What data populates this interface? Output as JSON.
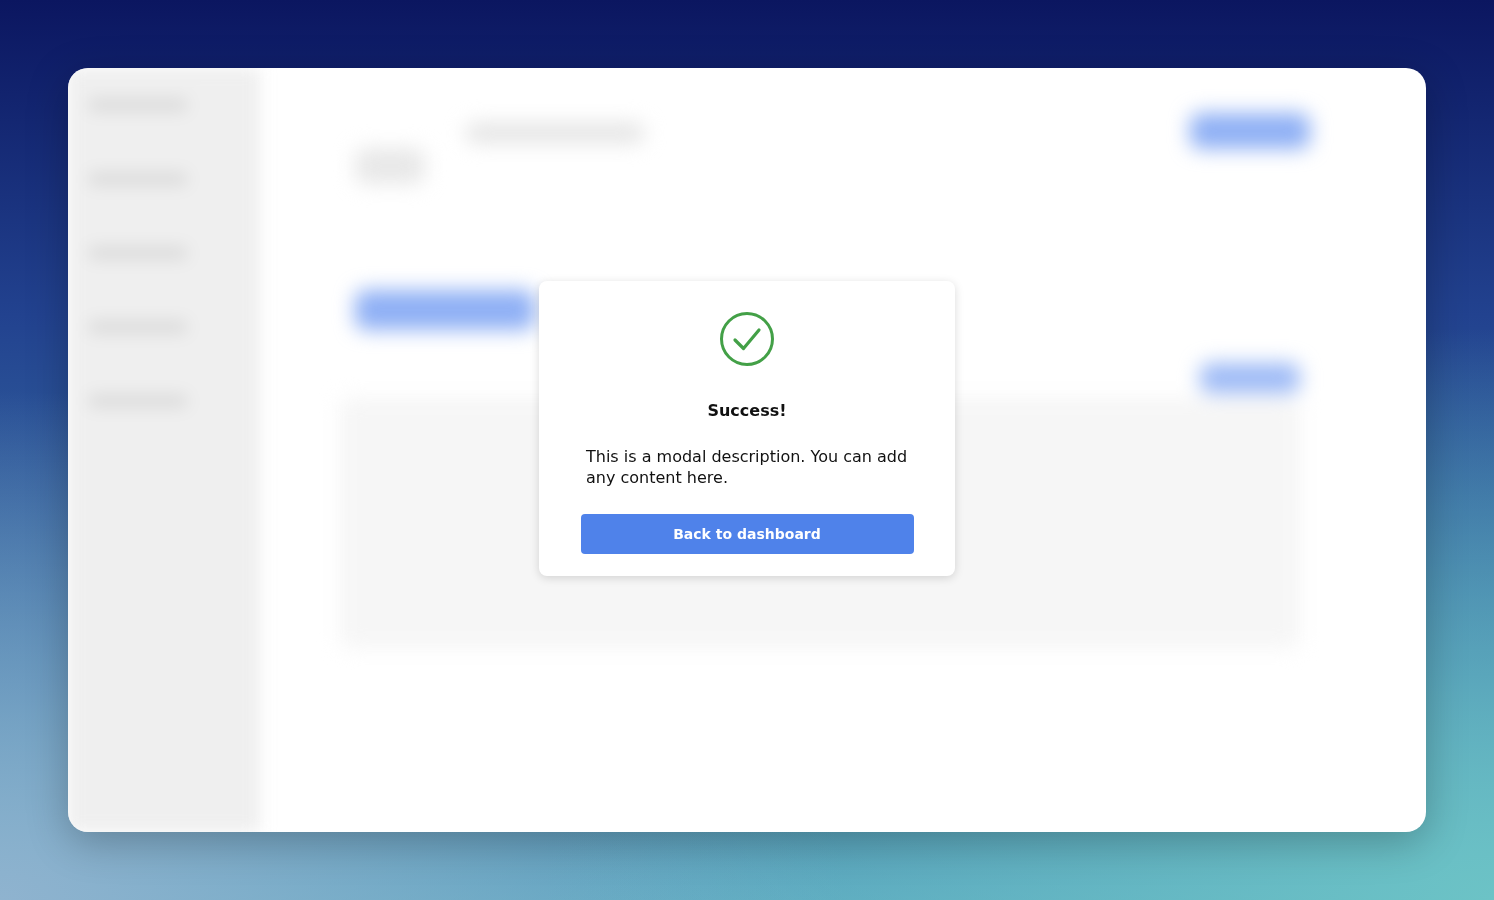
{
  "modal": {
    "title": "Success!",
    "description": "This is a modal description. You can add any content here.",
    "button": "Back to dashboard"
  }
}
